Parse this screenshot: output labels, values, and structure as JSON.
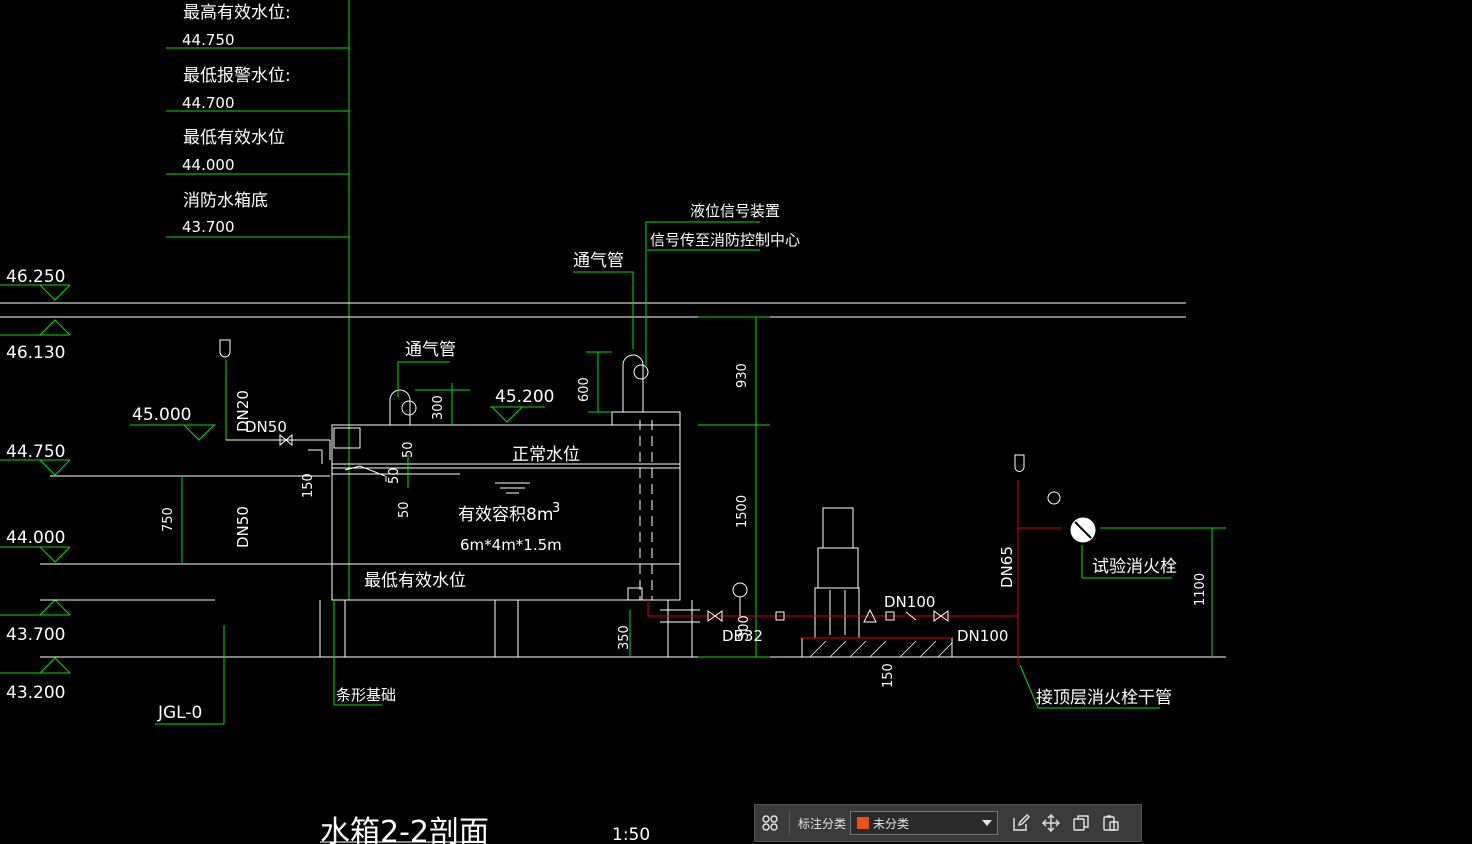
{
  "drawing": {
    "title": "水箱2-2剖面",
    "scale": "1:50",
    "water_levels": [
      {
        "label": "最高有效水位:",
        "value": "44.750"
      },
      {
        "label": "最低报警水位:",
        "value": "44.700"
      },
      {
        "label": "最低有效水位",
        "value": "44.000"
      },
      {
        "label": "消防水箱底",
        "value": "43.700"
      }
    ],
    "elevations": {
      "e46250": "46.250",
      "e46130": "46.130",
      "e45000": "45.000",
      "e44750": "44.750",
      "e44000": "44.000",
      "e43700": "43.700",
      "e43200": "43.200",
      "e45200": "45.200"
    },
    "labels": {
      "level_device": "液位信号装置",
      "signal_to": "信号传至消防控制中心",
      "vent_pipe_1": "通气管",
      "vent_pipe_2": "通气管",
      "normal_level": "正常水位",
      "effective_volume": "有效容积8m",
      "volume_superscript": "3",
      "tank_size": "6m*4m*1.5m",
      "min_effective": "最低有效水位",
      "strip_foundation": "条形基础",
      "test_hydrant": "试验消火栓",
      "roof_hydrant_main": "接顶层消火栓干管",
      "jgl": "JGL-0"
    },
    "pipes": {
      "dn20": "DN20",
      "dn50_a": "DN50",
      "dn50_b": "DN50",
      "dn100_a": "DN100",
      "dn100_b": "DN100",
      "dn65": "DN65",
      "db32": "DB32"
    },
    "dims": {
      "d930": "930",
      "d1500": "1500",
      "d600": "600",
      "d300": "300",
      "d50a": "50",
      "d50b": "50",
      "d50c": "50",
      "d150a": "150",
      "d150b": "150",
      "d750": "750",
      "d350": "350",
      "d300b": "300",
      "d1100": "1100"
    }
  },
  "toolbar": {
    "label": "标注分类",
    "selected": "未分类",
    "swatch_color": "#e8521a",
    "icons": [
      "grid-icon",
      "edit-icon",
      "move-icon",
      "copy-icon",
      "paste-icon"
    ]
  },
  "colors": {
    "green": "#00e000",
    "white": "#ffffff",
    "red": "#e00000"
  }
}
